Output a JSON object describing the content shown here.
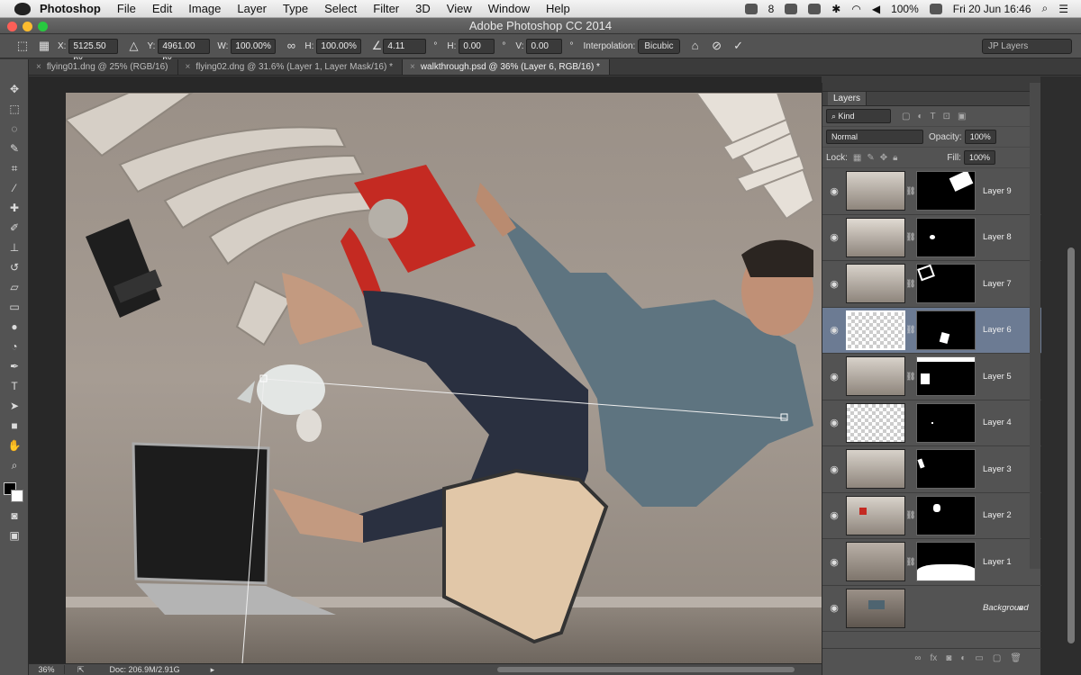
{
  "menubar": {
    "app": "Photoshop",
    "items": [
      "File",
      "Edit",
      "Image",
      "Layer",
      "Type",
      "Select",
      "Filter",
      "3D",
      "View",
      "Window",
      "Help"
    ],
    "tray_count": "8",
    "battery": "100%",
    "datetime": "Fri 20 Jun  16:46"
  },
  "window": {
    "title": "Adobe Photoshop CC 2014"
  },
  "options": {
    "x_label": "X:",
    "x_value": "5125.50 px",
    "y_label": "Y:",
    "y_value": "4961.00 px",
    "w_label": "W:",
    "w_value": "100.00%",
    "h_label": "H:",
    "h_value": "100.00%",
    "angle_value": "4.11",
    "hskew_label": "H:",
    "hskew_value": "0.00",
    "vskew_label": "V:",
    "vskew_value": "0.00",
    "degree": "°",
    "interp_label": "Interpolation:",
    "interp_value": "Bicubic",
    "workspace": "JP Layers"
  },
  "tabs": [
    {
      "label": "flying01.dng @ 25% (RGB/16)"
    },
    {
      "label": "flying02.dng @ 31.6% (Layer 1, Layer Mask/16) *"
    },
    {
      "label": "walkthrough.psd @ 36% (Layer 6, RGB/16) *"
    }
  ],
  "status": {
    "zoom": "36%",
    "doc": "Doc: 206.9M/2.91G"
  },
  "layers_panel": {
    "title": "Layers",
    "filter_kind": "Kind",
    "blend_mode": "Normal",
    "opacity_label": "Opacity:",
    "opacity_value": "100%",
    "lock_label": "Lock:",
    "fill_label": "Fill:",
    "fill_value": "100%",
    "layers": [
      {
        "name": "Layer 9"
      },
      {
        "name": "Layer 8"
      },
      {
        "name": "Layer 7"
      },
      {
        "name": "Layer 6",
        "selected": true
      },
      {
        "name": "Layer 5"
      },
      {
        "name": "Layer 4"
      },
      {
        "name": "Layer 3"
      },
      {
        "name": "Layer 2"
      },
      {
        "name": "Layer 1"
      },
      {
        "name": "Background"
      }
    ]
  },
  "colors": {
    "selected_layer": "#6c7b93",
    "panel_bg": "#535353",
    "canvas_bg": "#282828"
  }
}
